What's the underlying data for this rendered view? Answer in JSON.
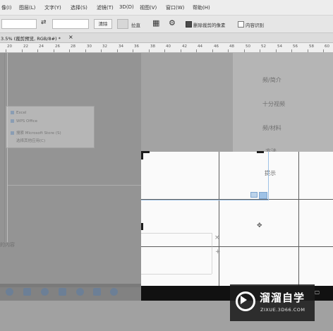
{
  "menubar": {
    "items": [
      "像(I)",
      "图层(L)",
      "文字(Y)",
      "选择(S)",
      "滤镜(T)",
      "3D(D)",
      "视图(V)",
      "窗口(W)",
      "帮助(H)"
    ]
  },
  "optionsbar": {
    "clear_label": "清除",
    "straighten_label": "拉直",
    "delete_cropped_label": "删除裁剪的像素",
    "content_aware_label": "内容识别"
  },
  "tab": {
    "title": "3.5% (裁剪预览, RGB/8#) *",
    "close": "×"
  },
  "ruler": {
    "ticks": [
      "20",
      "22",
      "24",
      "26",
      "28",
      "30",
      "32",
      "34",
      "36",
      "38",
      "40",
      "42",
      "44",
      "46",
      "48",
      "50",
      "52",
      "54",
      "56",
      "58",
      "60"
    ]
  },
  "ghost_panel": {
    "items": [
      "Excel",
      "WPS Office",
      "搜索 Microsoft Store (S)",
      "选择其他应用(C)"
    ],
    "right_texts": [
      "频/简介",
      "十分视频",
      "频/材料",
      "方法",
      "提示"
    ],
    "bottom_text": "的内容"
  },
  "watermark": {
    "title": "溜溜自学",
    "url": "ZIXUE.3D66.COM"
  },
  "colors": {
    "accent": "#9ec2e6",
    "canvas": "#a3a3a3"
  }
}
